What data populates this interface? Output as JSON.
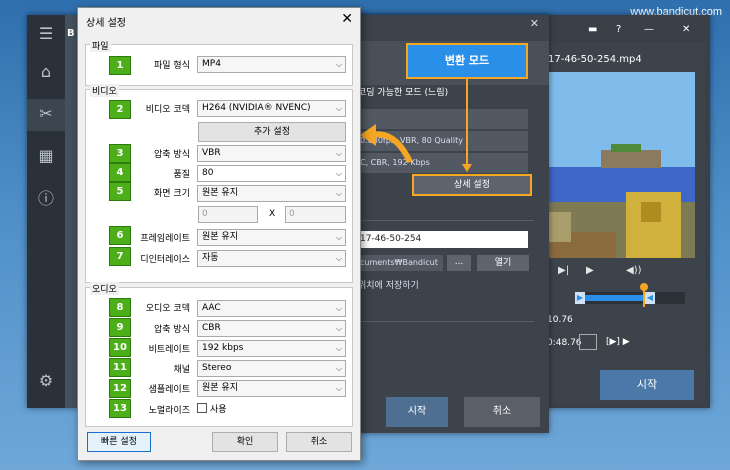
{
  "watermark": "www.bandicut.com",
  "app": {
    "left_title": "B",
    "sidebar_icons": [
      "menu-icon",
      "home-icon",
      "cut-icon",
      "film-icon",
      "info-icon",
      "settings-icon"
    ]
  },
  "conversion": {
    "mode_button": "변환 모드",
    "mode_desc": "코딩 가능한 모드 (느림)",
    "row1": "",
    "row2": "0.000fps, VBR, 80 Quality",
    "row3": "C, CBR, 192 Kbps",
    "advanced_button": "상세 설정",
    "file_name": "17-46-50-254",
    "folder": "cuments₩Bandicut",
    "dots_button": "...",
    "open_button": "열기",
    "save_option": "위치에 저장하기",
    "start_button": "시작",
    "cancel_button": "취소"
  },
  "preview": {
    "file_name": "17-46-50-254.mp4",
    "top_icons": [
      "folder-icon",
      "help-icon",
      "minimize-icon",
      "close-icon"
    ],
    "time_start": "10.76",
    "time_end": "0:48.76",
    "skip_controls": "[▶]  ▶",
    "start_button": "시작",
    "accent": "#2a8fe8"
  },
  "dialog": {
    "title": "상세 설정",
    "groups": {
      "file": "파일",
      "video": "비디오",
      "audio": "오디오"
    },
    "file_format": {
      "label": "파일 형식",
      "badge": "1",
      "value": "MP4"
    },
    "video_codec": {
      "label": "비디오 코덱",
      "badge": "2",
      "value": "H264 (NVIDIA® NVENC)"
    },
    "extra_settings": "추가 설정",
    "compression": {
      "label": "압축 방식",
      "badge": "3",
      "value": "VBR"
    },
    "quality": {
      "label": "품질",
      "badge": "4",
      "value": "80"
    },
    "screen_size": {
      "label": "화면 크기",
      "badge": "5",
      "value": "원본 유지",
      "width": "0",
      "x": "X",
      "height": "0"
    },
    "frame_rate": {
      "label": "프레임레이트",
      "badge": "6",
      "value": "원본 유지"
    },
    "deinterlace": {
      "label": "디인터레이스",
      "badge": "7",
      "value": "자동"
    },
    "audio_codec": {
      "label": "오디오 코덱",
      "badge": "8",
      "value": "AAC"
    },
    "audio_compression": {
      "label": "압축 방식",
      "badge": "9",
      "value": "CBR"
    },
    "bitrate": {
      "label": "비트레이트",
      "badge": "10",
      "value": "192 kbps"
    },
    "channel": {
      "label": "채널",
      "badge": "11",
      "value": "Stereo"
    },
    "sample_rate": {
      "label": "샘플레이트",
      "badge": "12",
      "value": "원본 유지"
    },
    "normalize": {
      "label": "노멀라이즈",
      "badge": "13",
      "checkbox_label": "사용",
      "checked": false
    },
    "quick_button": "빠른 설정",
    "ok_button": "확인",
    "cancel_button": "취소"
  }
}
